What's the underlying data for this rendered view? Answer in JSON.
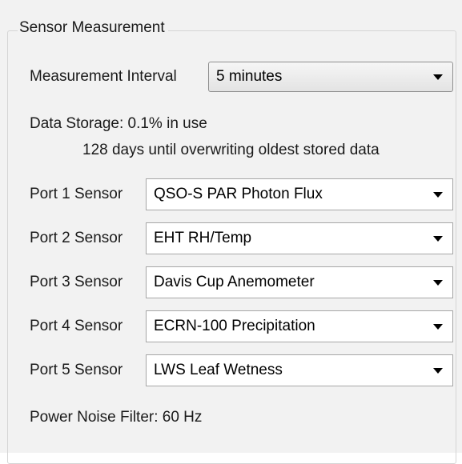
{
  "group": {
    "title": "Sensor Measurement"
  },
  "interval": {
    "label": "Measurement Interval",
    "value": "5 minutes"
  },
  "storage": {
    "line1": "Data Storage: 0.1% in use",
    "line2": "128 days until overwriting oldest stored data"
  },
  "ports": [
    {
      "label": "Port 1 Sensor",
      "value": "QSO-S PAR Photon Flux"
    },
    {
      "label": "Port 2 Sensor",
      "value": "EHT RH/Temp"
    },
    {
      "label": "Port 3 Sensor",
      "value": "Davis Cup Anemometer"
    },
    {
      "label": "Port 4 Sensor",
      "value": "ECRN-100 Precipitation"
    },
    {
      "label": "Port 5 Sensor",
      "value": "LWS Leaf Wetness"
    }
  ],
  "power_filter": {
    "text": "Power Noise Filter: 60 Hz"
  },
  "icons": {
    "dropdown": "chevron-down-icon"
  },
  "colors": {
    "panel_bg": "#f2f2f2",
    "border": "#a6a6a6"
  }
}
